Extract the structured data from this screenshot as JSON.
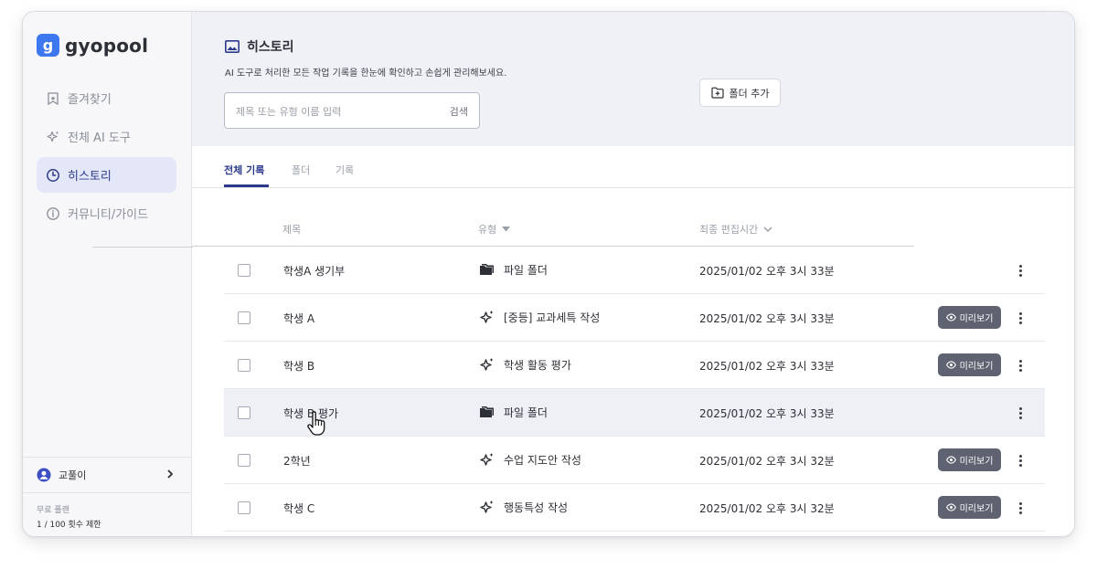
{
  "brand": {
    "name": "gyopool",
    "mark": "g",
    "color": "#3d78f0"
  },
  "sidebar": {
    "items": [
      {
        "label": "즐겨찾기",
        "icon": "bookmark-icon",
        "active": false
      },
      {
        "label": "전체 AI 도구",
        "icon": "sparkle-icon",
        "active": false
      },
      {
        "label": "히스토리",
        "icon": "clock-icon",
        "active": true
      },
      {
        "label": "커뮤니티/가이드",
        "icon": "info-icon",
        "active": false
      }
    ],
    "user": {
      "name": "교풀이"
    },
    "plan": {
      "label": "무료 플랜",
      "limit": "1 / 100 횟수 제한"
    }
  },
  "header": {
    "title": "히스토리",
    "description": "AI 도구로 처리한 모든 작업 기록을 한눈에 확인하고 손쉽게 관리해보세요.",
    "search_placeholder": "제목 또는 유형 이름 입력",
    "search_button": "검색",
    "add_folder_label": "폴더 추가"
  },
  "tabs": [
    {
      "label": "전체 기록",
      "active": true
    },
    {
      "label": "폴더",
      "active": false
    },
    {
      "label": "기록",
      "active": false
    }
  ],
  "table": {
    "columns": {
      "title": "제목",
      "type": "유형",
      "edited": "최종 편집시간"
    },
    "preview_label": "미리보기",
    "rows": [
      {
        "title": "학생A 생기부",
        "type": "파일 폴더",
        "type_icon": "folder-icon",
        "date": "2025/01/02 오후 3시 33분",
        "preview": false
      },
      {
        "title": "학생 A",
        "type": "[중등] 교과세특 작성",
        "type_icon": "sparkle-icon",
        "date": "2025/01/02 오후 3시 33분",
        "preview": true
      },
      {
        "title": "학생 B",
        "type": "학생 활동 평가",
        "type_icon": "sparkle-icon",
        "date": "2025/01/02 오후 3시 33분",
        "preview": true
      },
      {
        "title": "학생 B 평가",
        "type": "파일 폴더",
        "type_icon": "folder-icon",
        "date": "2025/01/02 오후 3시 33분",
        "preview": false
      },
      {
        "title": "2학년",
        "type": "수업 지도안 작성",
        "type_icon": "sparkle-icon",
        "date": "2025/01/02 오후 3시 32분",
        "preview": true
      },
      {
        "title": "학생 C",
        "type": "행동특성 작성",
        "type_icon": "sparkle-icon",
        "date": "2025/01/02 오후 3시 32분",
        "preview": true
      }
    ]
  },
  "colors": {
    "accent": "#2d3a8c",
    "preview_bg": "#5f6270",
    "header_bg": "#f0f1f6"
  }
}
